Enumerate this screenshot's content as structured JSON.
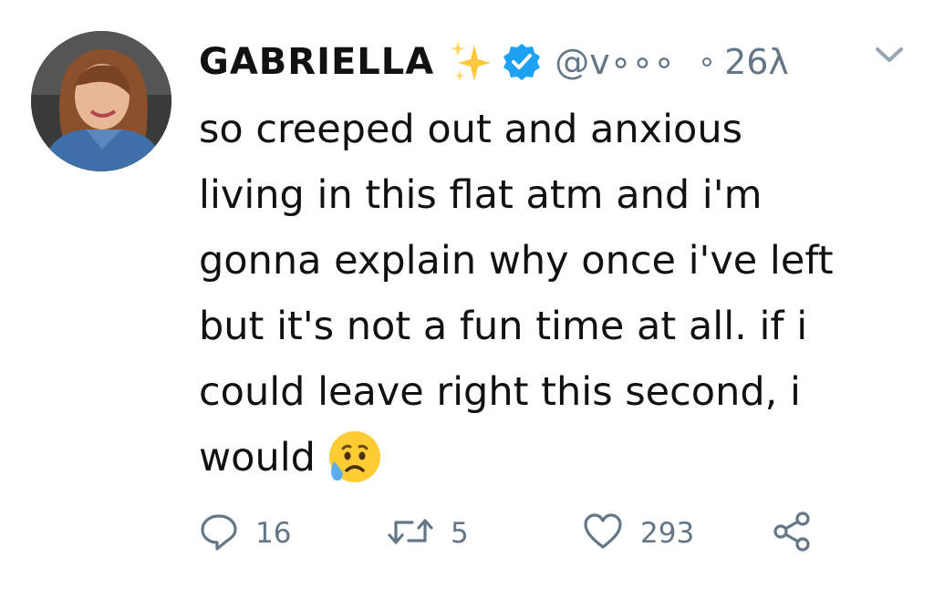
{
  "tweet": {
    "display_name": "GABRIELLA",
    "handle": "@v∘∘∘",
    "timestamp": "26λ",
    "body_lines": [
      "so creeped out and anxious",
      "living in this flat atm and i'm",
      "gonna explain why once i've left",
      "but it's not a fun time at all. if i",
      "could leave right this second, i",
      "would"
    ],
    "emoji": "sad-but-relieved-face-icon",
    "actions": {
      "replies": "16",
      "retweets": "5",
      "likes": "293"
    }
  },
  "colors": {
    "text": "#111111",
    "muted": "#657786",
    "verified": "#1DA1F2",
    "sparkle": "#FFC83D",
    "emoji_face": "#FFCC33",
    "tear": "#5DADEC"
  },
  "icons": {
    "name_decoration": "sparkles-icon",
    "verified": "verified-badge-icon",
    "menu": "chevron-down-icon",
    "reply": "reply-bubble-icon",
    "retweet": "retweet-icon",
    "like": "heart-icon",
    "share": "share-icon"
  }
}
